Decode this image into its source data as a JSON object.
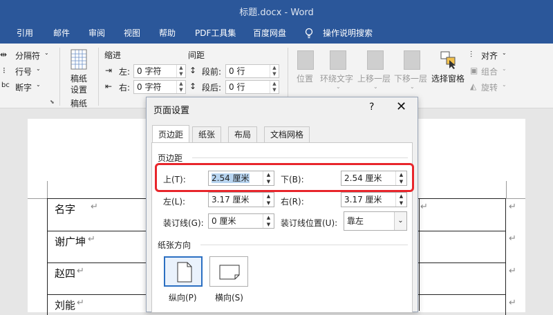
{
  "window": {
    "title": "标题.docx  -  Word"
  },
  "menu": {
    "tabs": [
      "引用",
      "邮件",
      "审阅",
      "视图",
      "帮助",
      "PDF工具集",
      "百度网盘"
    ],
    "tell_me": "操作说明搜索"
  },
  "ribbon": {
    "breaks": "分隔符",
    "line_numbers": "行号",
    "hyphenation": "断字",
    "draft_paper_top": "稿纸",
    "draft_paper_bottom": "设置",
    "draft_paper_group": "稿纸",
    "indent_title": "缩进",
    "indent_left_label": "左:",
    "indent_left_value": "0 字符",
    "indent_right_label": "右:",
    "indent_right_value": "0 字符",
    "spacing_title": "间距",
    "spacing_before_label": "段前:",
    "spacing_before_value": "0 行",
    "spacing_after_label": "段后:",
    "spacing_after_value": "0 行",
    "arrange": {
      "position": "位置",
      "wrap_text": "环绕文字",
      "bring_forward": "上移一层",
      "send_backward": "下移一层",
      "selection_pane": "选择窗格",
      "align": "对齐",
      "group": "组合",
      "rotate": "旋转"
    }
  },
  "document": {
    "rows": [
      "名字",
      "谢广坤",
      "赵四",
      "刘能"
    ],
    "pilcrow": "↵"
  },
  "dialog": {
    "title": "页面设置",
    "help": "?",
    "close": "✕",
    "tabs": [
      "页边距",
      "纸张",
      "布局",
      "文档网格"
    ],
    "margins_section": "页边距",
    "top_label": "上(T):",
    "top_value": "2.54 厘米",
    "bottom_label": "下(B):",
    "bottom_value": "2.54 厘米",
    "left_label": "左(L):",
    "left_value": "3.17 厘米",
    "right_label": "右(R):",
    "right_value": "3.17 厘米",
    "gutter_label": "装订线(G):",
    "gutter_value": "0 厘米",
    "gutter_pos_label": "装订线位置(U):",
    "gutter_pos_value": "靠左",
    "orientation_section": "纸张方向",
    "portrait": "纵向(P)",
    "landscape": "横向(S)"
  },
  "colors": {
    "word_blue": "#2b579a",
    "highlight_red": "#e8252b",
    "selection": "#b7d4f0"
  }
}
